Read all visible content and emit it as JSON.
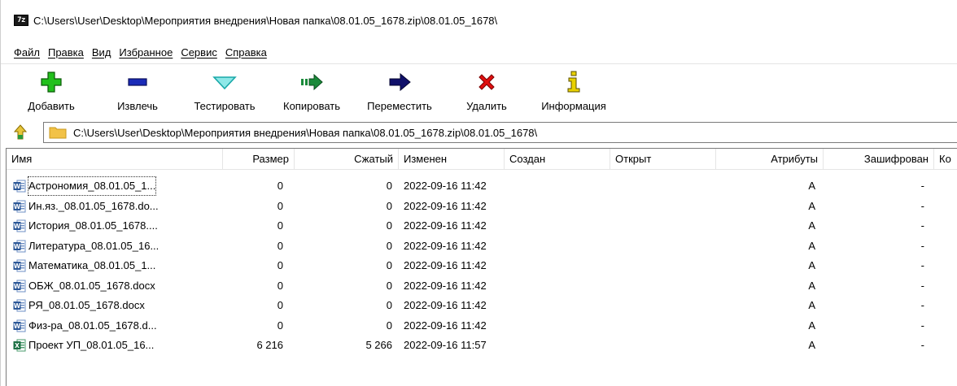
{
  "window": {
    "title": "C:\\Users\\User\\Desktop\\Мероприятия внедрения\\Новая папка\\08.01.05_1678.zip\\08.01.05_1678\\",
    "app_badge": "7z"
  },
  "menu": [
    "Файл",
    "Правка",
    "Вид",
    "Избранное",
    "Сервис",
    "Справка"
  ],
  "toolbar": [
    {
      "label": "Добавить",
      "icon": "plus-icon",
      "color": "#22c01c"
    },
    {
      "label": "Извлечь",
      "icon": "minus-icon",
      "color": "#1a2bb8"
    },
    {
      "label": "Тестировать",
      "icon": "check-icon",
      "color": "#2bc6c6"
    },
    {
      "label": "Копировать",
      "icon": "copy-arrow-icon",
      "color": "#1a8a3a"
    },
    {
      "label": "Переместить",
      "icon": "move-arrow-icon",
      "color": "#10106a"
    },
    {
      "label": "Удалить",
      "icon": "delete-x-icon",
      "color": "#e01010"
    },
    {
      "label": "Информация",
      "icon": "info-icon",
      "color": "#b8a000"
    }
  ],
  "address": {
    "path": "C:\\Users\\User\\Desktop\\Мероприятия внедрения\\Новая папка\\08.01.05_1678.zip\\08.01.05_1678\\"
  },
  "columns": [
    "Имя",
    "Размер",
    "Сжатый",
    "Изменен",
    "Создан",
    "Открыт",
    "Атрибуты",
    "Зашифрован",
    "Ко"
  ],
  "files": [
    {
      "name": "Астрономия_08.01.05_1...",
      "size": "0",
      "packed": "0",
      "modified": "2022-09-16 11:42",
      "created": "",
      "accessed": "",
      "attr": "A",
      "encrypted": "-",
      "type": "word"
    },
    {
      "name": "Ин.яз._08.01.05_1678.do...",
      "size": "0",
      "packed": "0",
      "modified": "2022-09-16 11:42",
      "created": "",
      "accessed": "",
      "attr": "A",
      "encrypted": "-",
      "type": "word"
    },
    {
      "name": "История_08.01.05_1678....",
      "size": "0",
      "packed": "0",
      "modified": "2022-09-16 11:42",
      "created": "",
      "accessed": "",
      "attr": "A",
      "encrypted": "-",
      "type": "word"
    },
    {
      "name": "Литература_08.01.05_16...",
      "size": "0",
      "packed": "0",
      "modified": "2022-09-16 11:42",
      "created": "",
      "accessed": "",
      "attr": "A",
      "encrypted": "-",
      "type": "word"
    },
    {
      "name": "Математика_08.01.05_1...",
      "size": "0",
      "packed": "0",
      "modified": "2022-09-16 11:42",
      "created": "",
      "accessed": "",
      "attr": "A",
      "encrypted": "-",
      "type": "word"
    },
    {
      "name": "ОБЖ_08.01.05_1678.docx",
      "size": "0",
      "packed": "0",
      "modified": "2022-09-16 11:42",
      "created": "",
      "accessed": "",
      "attr": "A",
      "encrypted": "-",
      "type": "word"
    },
    {
      "name": "РЯ_08.01.05_1678.docx",
      "size": "0",
      "packed": "0",
      "modified": "2022-09-16 11:42",
      "created": "",
      "accessed": "",
      "attr": "A",
      "encrypted": "-",
      "type": "word"
    },
    {
      "name": "Физ-ра_08.01.05_1678.d...",
      "size": "0",
      "packed": "0",
      "modified": "2022-09-16 11:42",
      "created": "",
      "accessed": "",
      "attr": "A",
      "encrypted": "-",
      "type": "word"
    },
    {
      "name": "Проект УП_08.01.05_16...",
      "size": "6 216",
      "packed": "5 266",
      "modified": "2022-09-16 11:57",
      "created": "",
      "accessed": "",
      "attr": "A",
      "encrypted": "-",
      "type": "excel"
    }
  ],
  "colors": {
    "word": "#2b5797",
    "excel": "#1e7145",
    "folder": "#f2c247"
  }
}
